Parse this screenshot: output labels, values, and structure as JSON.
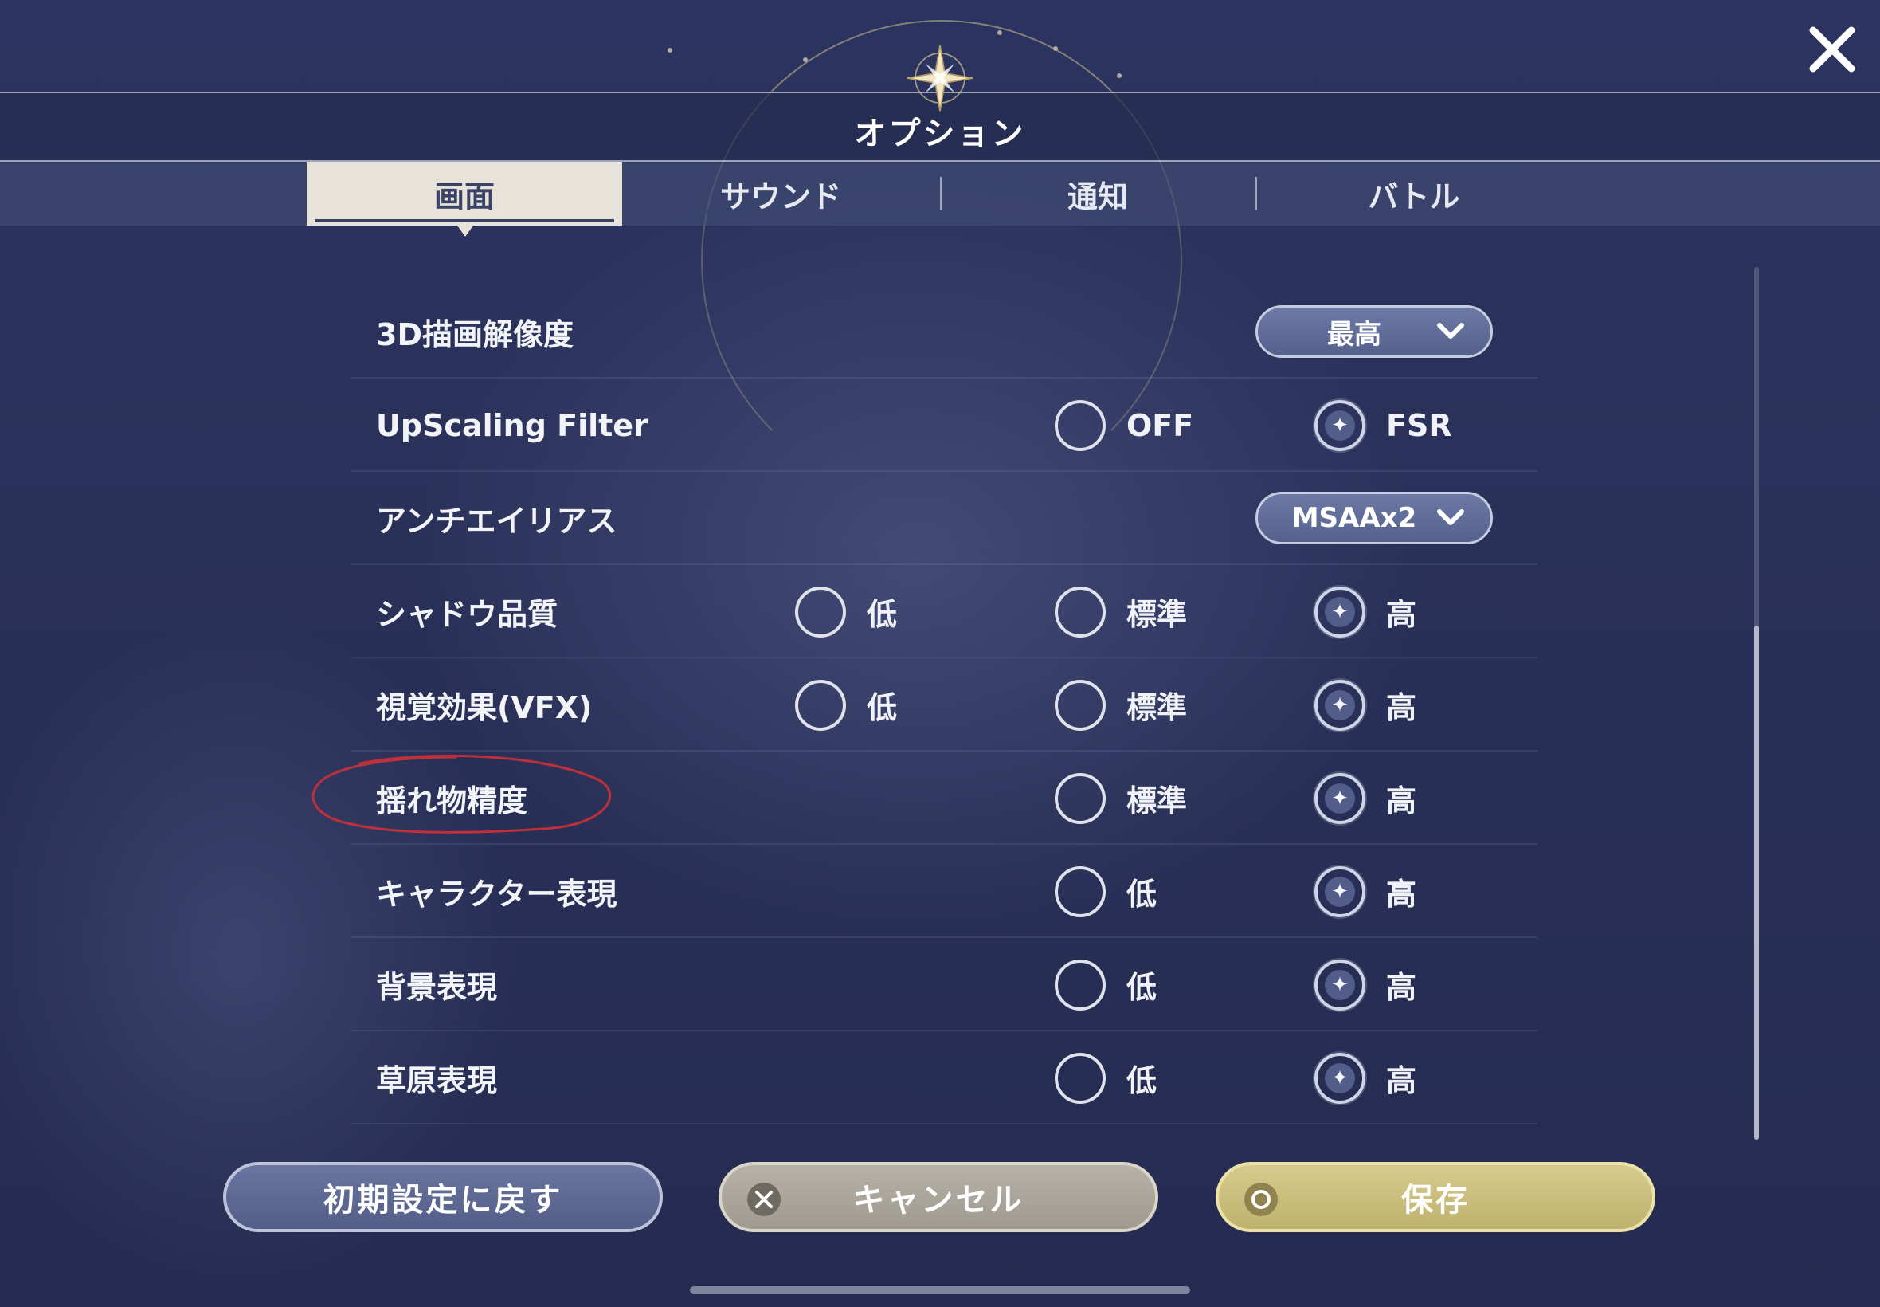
{
  "header": {
    "title": "オプション"
  },
  "tabs": [
    {
      "label": "画面",
      "active": true
    },
    {
      "label": "サウンド",
      "active": false
    },
    {
      "label": "通知",
      "active": false
    },
    {
      "label": "バトル",
      "active": false
    }
  ],
  "settings": {
    "resolution": {
      "label": "3D描画解像度",
      "value": "最高"
    },
    "upscaling": {
      "label": "UpScaling Filter",
      "options": [
        "OFF",
        "FSR"
      ],
      "selected": "FSR"
    },
    "antialias": {
      "label": "アンチエイリアス",
      "value": "MSAAx2"
    },
    "shadow": {
      "label": "シャドウ品質",
      "options": [
        "低",
        "標準",
        "高"
      ],
      "selected": "高"
    },
    "vfx": {
      "label": "視覚効果(VFX)",
      "options": [
        "低",
        "標準",
        "高"
      ],
      "selected": "高"
    },
    "sway": {
      "label": "揺れ物精度",
      "options": [
        "標準",
        "高"
      ],
      "selected": "高"
    },
    "character": {
      "label": "キャラクター表現",
      "options": [
        "低",
        "高"
      ],
      "selected": "高"
    },
    "background": {
      "label": "背景表現",
      "options": [
        "低",
        "高"
      ],
      "selected": "高"
    },
    "grass": {
      "label": "草原表現",
      "options": [
        "低",
        "高"
      ],
      "selected": "高"
    }
  },
  "buttons": {
    "reset": "初期設定に戻す",
    "cancel": "キャンセル",
    "save": "保存"
  },
  "icons": {
    "close": "close-icon",
    "emblem": "compass-star-icon",
    "cancel": "x-circle-icon",
    "save": "o-circle-icon",
    "dropdown": "chevron-down-icon",
    "radio_selected": "sparkle-icon"
  },
  "colors": {
    "background": "#2a3159",
    "tab_active": "#e8e3d8",
    "dropdown": "#5f6b97",
    "reset_button": "#5e6994",
    "cancel_button": "#aaa69c",
    "save_button": "#ccc07e",
    "annotation": "#c0303a"
  }
}
